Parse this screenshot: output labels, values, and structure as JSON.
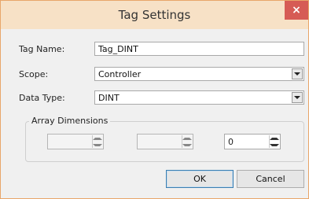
{
  "window": {
    "title": "Tag Settings",
    "close_label": "×"
  },
  "form": {
    "tag_name_label": "Tag Name:",
    "tag_name_value": "Tag_DINT",
    "scope_label": "Scope:",
    "scope_value": "Controller",
    "data_type_label": "Data Type:",
    "data_type_value": "DINT"
  },
  "array_dimensions": {
    "title": "Array Dimensions",
    "dim1": "",
    "dim2": "",
    "dim3": "0"
  },
  "buttons": {
    "ok": "OK",
    "cancel": "Cancel"
  },
  "colors": {
    "titlebar": "#f7e1c6",
    "close": "#d65b55",
    "border": "#e8a66a"
  }
}
